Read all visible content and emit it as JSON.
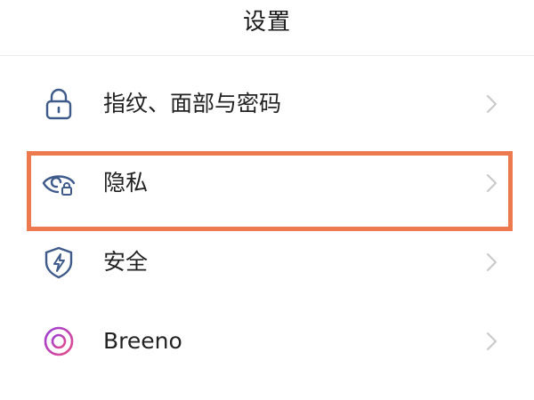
{
  "header": {
    "title": "设置"
  },
  "items": [
    {
      "label": "指纹、面部与密码",
      "icon": "lock-icon"
    },
    {
      "label": "隐私",
      "icon": "privacy-eye-lock-icon"
    },
    {
      "label": "安全",
      "icon": "shield-bolt-icon"
    },
    {
      "label": "Breeno",
      "icon": "breeno-ring-icon"
    }
  ],
  "colors": {
    "icon_blue": "#3d5a8a",
    "highlight": "#ec7a4e",
    "chevron": "#c8c8c8",
    "breeno_gradient": [
      "#9b3dd8",
      "#e64b8b"
    ]
  }
}
